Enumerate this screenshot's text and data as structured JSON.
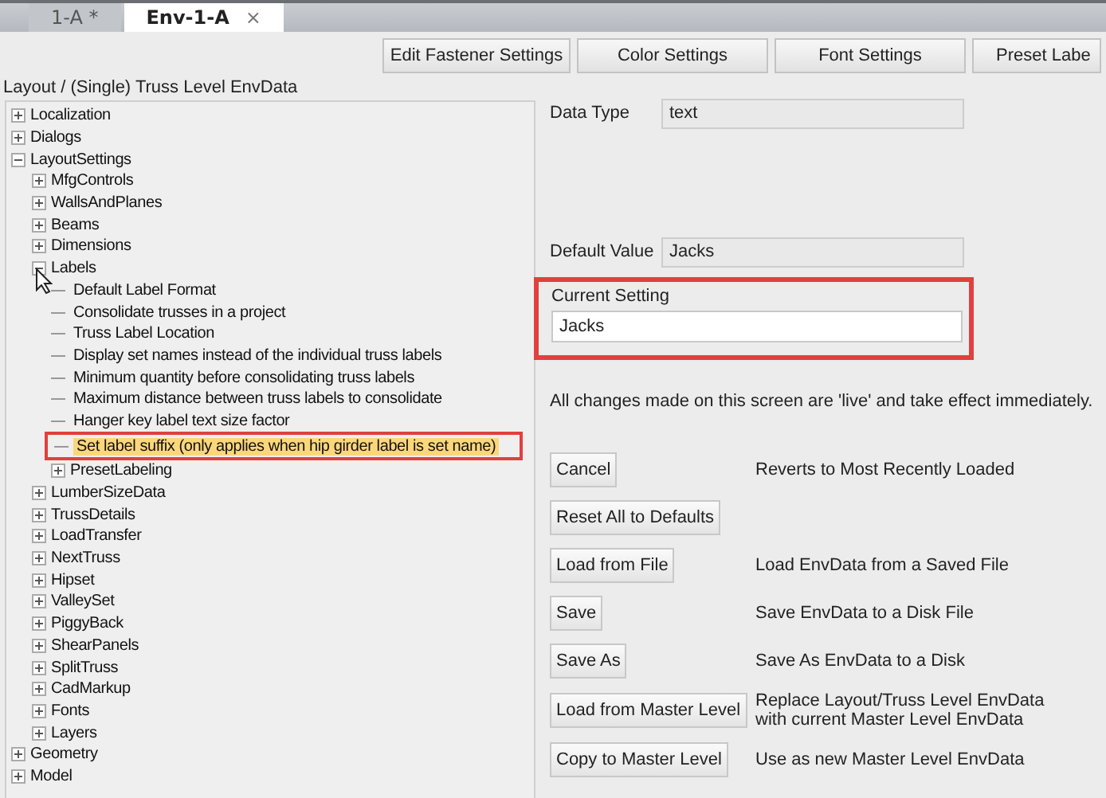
{
  "tabs": [
    {
      "label": "1-A *",
      "selected": false
    },
    {
      "label": "Env-1-A",
      "selected": true,
      "close": "×"
    }
  ],
  "toolbar_buttons": [
    "Edit Fastener Settings",
    "Color Settings",
    "Font Settings",
    "Preset Labe"
  ],
  "breadcrumb": "Layout / (Single) Truss Level EnvData",
  "tree": [
    {
      "label": "Localization",
      "expanded": false,
      "selected": false
    },
    {
      "label": "Dialogs",
      "expanded": false,
      "selected": false
    },
    {
      "label": "LayoutSettings",
      "expanded": true,
      "selected": false,
      "children": [
        {
          "label": "MfgControls",
          "expanded": false,
          "selected": false
        },
        {
          "label": "WallsAndPlanes",
          "expanded": false,
          "selected": false
        },
        {
          "label": "Beams",
          "expanded": false,
          "selected": false
        },
        {
          "label": "Dimensions",
          "expanded": false,
          "selected": false
        },
        {
          "label": "Labels",
          "expanded": true,
          "selected": false,
          "children": [
            {
              "label": "Default Label Format",
              "selected": false
            },
            {
              "label": "Consolidate trusses in a project",
              "selected": false
            },
            {
              "label": "Truss Label Location",
              "selected": false
            },
            {
              "label": "Display set names instead of the individual truss labels",
              "selected": false
            },
            {
              "label": "Minimum quantity before consolidating truss labels",
              "selected": false
            },
            {
              "label": "Maximum distance between truss labels to consolidate",
              "selected": false
            },
            {
              "label": "Hanger key label text size factor",
              "selected": false
            },
            {
              "label": "Set label suffix (only applies when hip girder label is set name)",
              "selected": true
            },
            {
              "label": "PresetLabeling",
              "expanded": false,
              "selected": false
            }
          ]
        },
        {
          "label": "LumberSizeData",
          "expanded": false,
          "selected": false
        },
        {
          "label": "TrussDetails",
          "expanded": false,
          "selected": false
        },
        {
          "label": "LoadTransfer",
          "expanded": false,
          "selected": false
        },
        {
          "label": "NextTruss",
          "expanded": false,
          "selected": false
        },
        {
          "label": "Hipset",
          "expanded": false,
          "selected": false
        },
        {
          "label": "ValleySet",
          "expanded": false,
          "selected": false
        },
        {
          "label": "PiggyBack",
          "expanded": false,
          "selected": false
        },
        {
          "label": "ShearPanels",
          "expanded": false,
          "selected": false
        },
        {
          "label": "SplitTruss",
          "expanded": false,
          "selected": false
        },
        {
          "label": "CadMarkup",
          "expanded": false,
          "selected": false
        },
        {
          "label": "Fonts",
          "expanded": false,
          "selected": false
        },
        {
          "label": "Layers",
          "expanded": false,
          "selected": false
        }
      ]
    },
    {
      "label": "Geometry",
      "expanded": false,
      "selected": false
    },
    {
      "label": "Model",
      "expanded": false,
      "selected": false
    }
  ],
  "data_type": {
    "label": "Data Type",
    "value": "text"
  },
  "default_value": {
    "label": "Default Value",
    "value": "Jacks"
  },
  "current_setting": {
    "label": "Current Setting",
    "value": "Jacks"
  },
  "note": "All changes made on this screen are 'live' and take effect immediately.",
  "actions": [
    {
      "button": "Cancel",
      "description": "Reverts to Most Recently Loaded"
    },
    {
      "button": "Reset All to Defaults"
    },
    {
      "button": "Load from File",
      "description": "Load EnvData from a Saved File"
    },
    {
      "button": "Save",
      "description": "Save EnvData to a Disk File"
    },
    {
      "button": "Save As",
      "description": "Save As EnvData to a Disk"
    },
    {
      "button": "Load from Master Level",
      "description": "Replace Layout/Truss Level EnvData with current Master Level EnvData"
    },
    {
      "button": "Copy to Master Level",
      "description": "Use as new Master Level EnvData"
    }
  ]
}
